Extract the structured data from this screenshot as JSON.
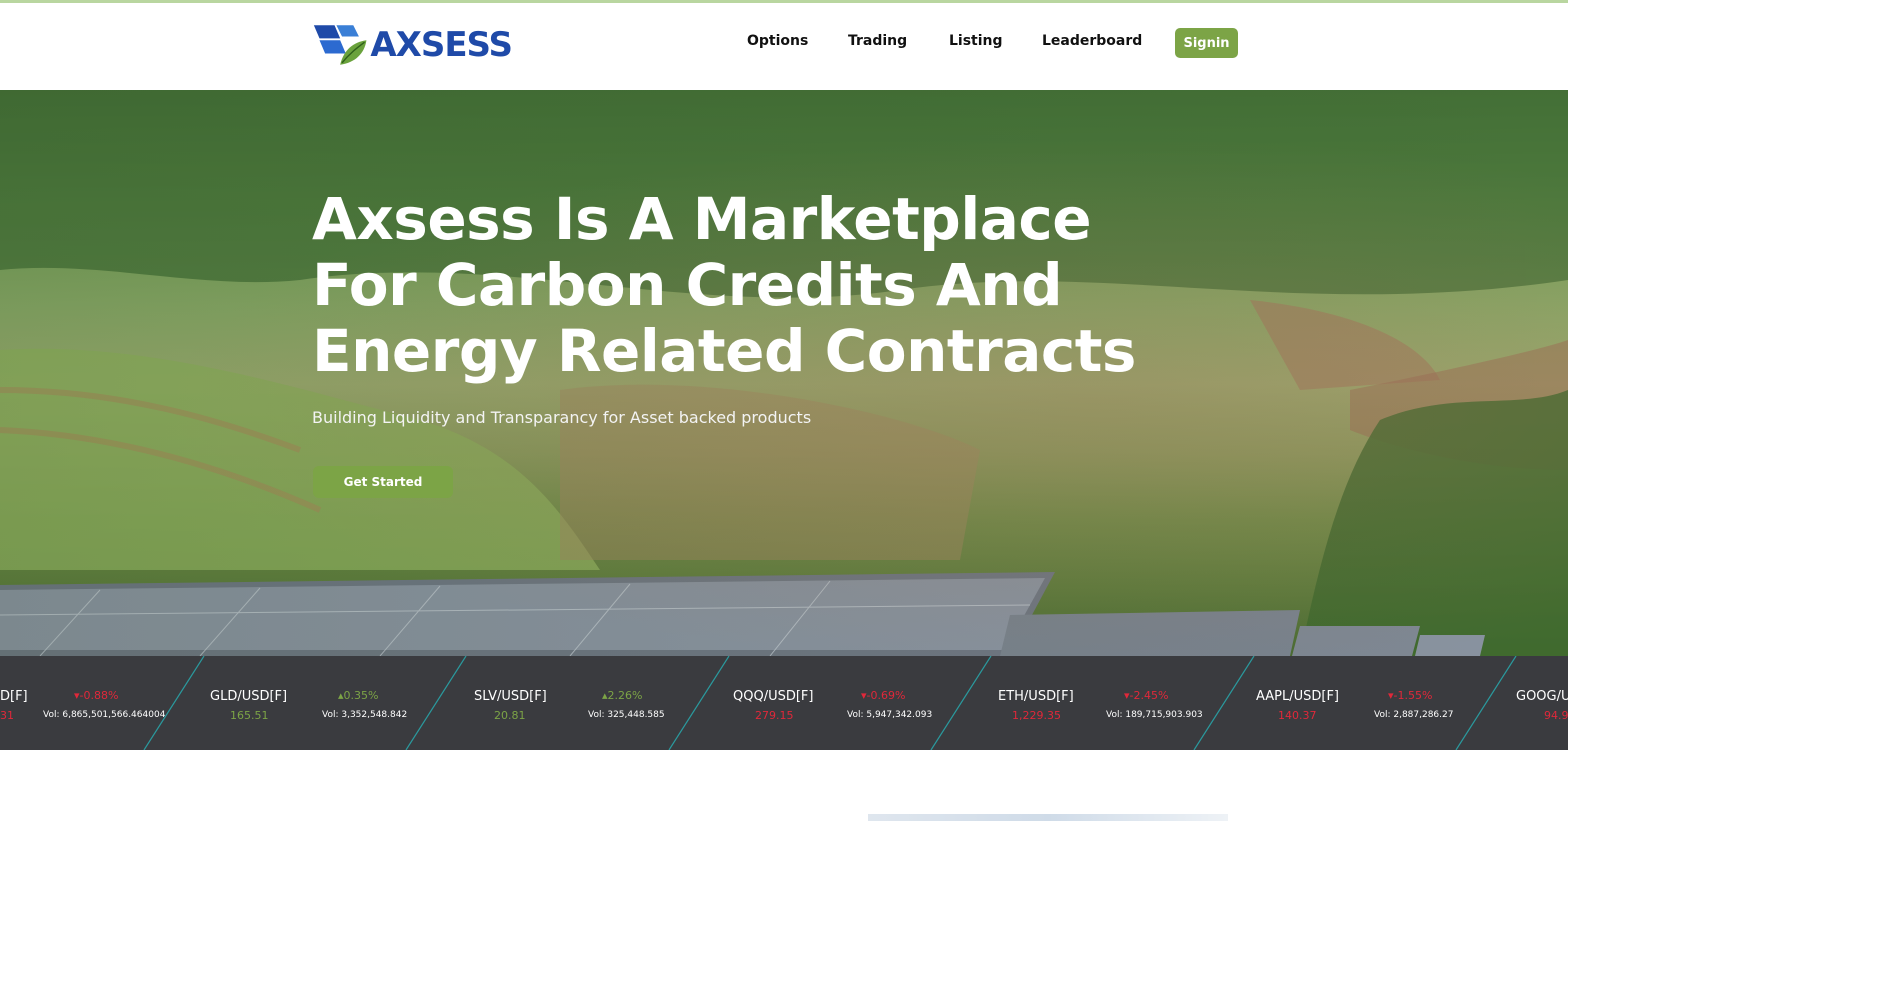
{
  "brand": {
    "name": "AXSESS",
    "colors": {
      "primary": "#1f4aa8",
      "accent": "#7ca446",
      "up": "#7ca446",
      "down": "#e0283a"
    }
  },
  "nav": {
    "items": [
      {
        "label": "Options"
      },
      {
        "label": "Trading"
      },
      {
        "label": "Listing"
      },
      {
        "label": "Leaderboard"
      }
    ],
    "signin_label": "Signin"
  },
  "hero": {
    "title": "Axsess Is A Marketplace For Carbon Credits And Energy Related Contracts",
    "subtitle": "Building Liquidity and Transparancy for Asset backed products",
    "cta_label": "Get Started"
  },
  "ticker": {
    "items": [
      {
        "symbol": "D[F]",
        "price": "31",
        "change": "-0.88%",
        "direction": "down",
        "volume": "Vol: 6,865,501,566.464004"
      },
      {
        "symbol": "GLD/USD[F]",
        "price": "165.51",
        "change": "0.35%",
        "direction": "up",
        "volume": "Vol: 3,352,548.842"
      },
      {
        "symbol": "SLV/USD[F]",
        "price": "20.81",
        "change": "2.26%",
        "direction": "up",
        "volume": "Vol: 325,448.585"
      },
      {
        "symbol": "QQQ/USD[F]",
        "price": "279.15",
        "change": "-0.69%",
        "direction": "down",
        "volume": "Vol: 5,947,342.093"
      },
      {
        "symbol": "ETH/USD[F]",
        "price": "1,229.35",
        "change": "-2.45%",
        "direction": "down",
        "volume": "Vol: 189,715,903.903"
      },
      {
        "symbol": "AAPL/USD[F]",
        "price": "140.37",
        "change": "-1.55%",
        "direction": "down",
        "volume": "Vol: 2,887,286.27"
      },
      {
        "symbol": "GOOG/U",
        "price": "94.9",
        "change": "",
        "direction": "down",
        "volume": ""
      }
    ]
  }
}
